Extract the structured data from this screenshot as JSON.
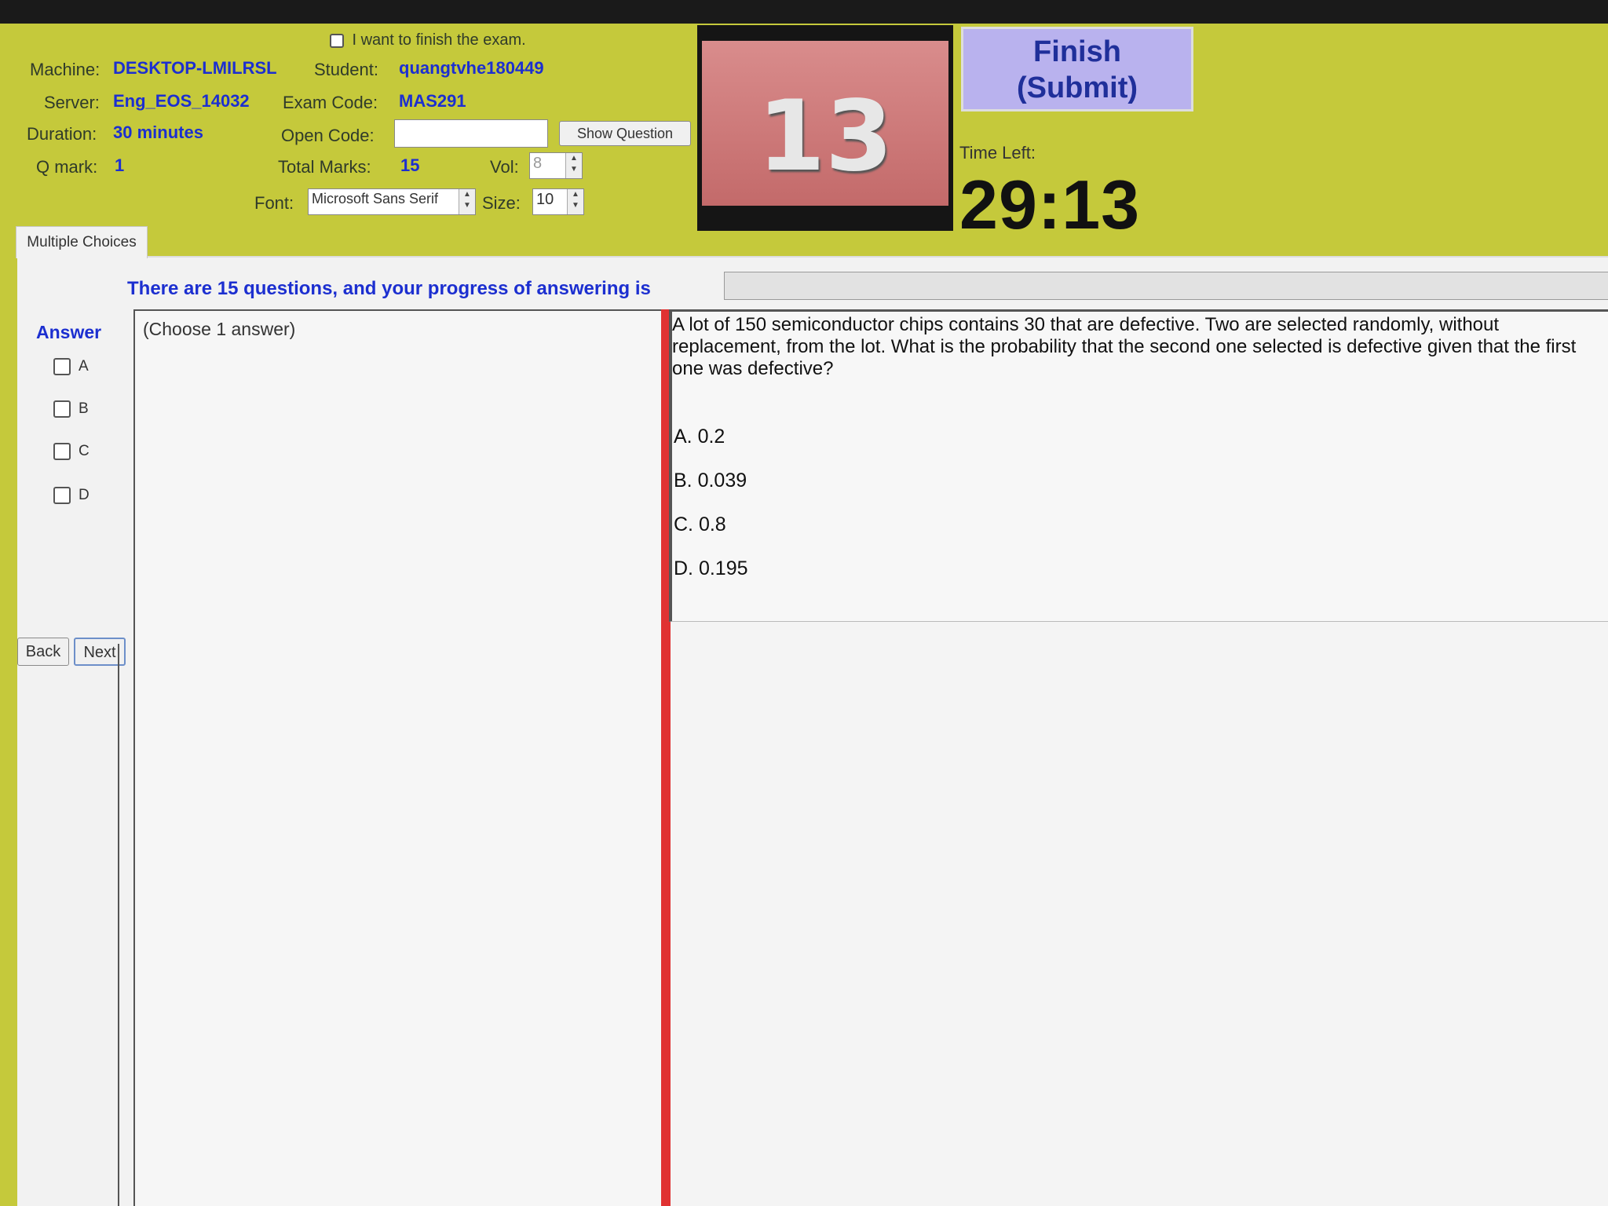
{
  "header": {
    "finish_checkbox_label": "I want to finish the exam.",
    "machine_label": "Machine:",
    "machine_value": "DESKTOP-LMILRSL",
    "student_label": "Student:",
    "student_value": "quangtvhe180449",
    "server_label": "Server:",
    "server_value": "Eng_EOS_14032",
    "exam_code_label": "Exam Code:",
    "exam_code_value": "MAS291",
    "duration_label": "Duration:",
    "duration_value": "30 minutes",
    "open_code_label": "Open Code:",
    "open_code_value": "",
    "show_question_label": "Show Question",
    "qmark_label": "Q mark:",
    "qmark_value": "1",
    "total_marks_label": "Total Marks:",
    "total_marks_value": "15",
    "vol_label": "Vol:",
    "vol_value": "8",
    "font_label": "Font:",
    "font_value": "Microsoft Sans Serif",
    "size_label": "Size:",
    "size_value": "10"
  },
  "question_number": "13",
  "finish_button": {
    "line1": "Finish",
    "line2": "(Submit)"
  },
  "timer": {
    "label": "Time Left:",
    "value": "29:13"
  },
  "tab": {
    "label": "Multiple Choices"
  },
  "progress": {
    "text": "There are 15 questions, and your progress of answering is",
    "fraction": 0
  },
  "answer_panel": {
    "title": "Answer",
    "options": [
      "A",
      "B",
      "C",
      "D"
    ],
    "choose_hint": "(Choose 1 answer)",
    "back_label": "Back",
    "next_label": "Next"
  },
  "question": {
    "text": "A lot of 150 semiconductor chips contains 30 that are defective. Two are selected randomly, without replacement, from the lot. What is the probability that the second one selected is defective given that the first one was defective?",
    "choices": [
      "A.  0.2",
      "B.  0.039",
      "C.  0.8",
      "D.  0.195"
    ]
  },
  "colors": {
    "background": "#c5c93b",
    "accent_blue": "#1c2fd0",
    "finish_button": "#b9b2ee",
    "red_divider": "#e03232"
  }
}
